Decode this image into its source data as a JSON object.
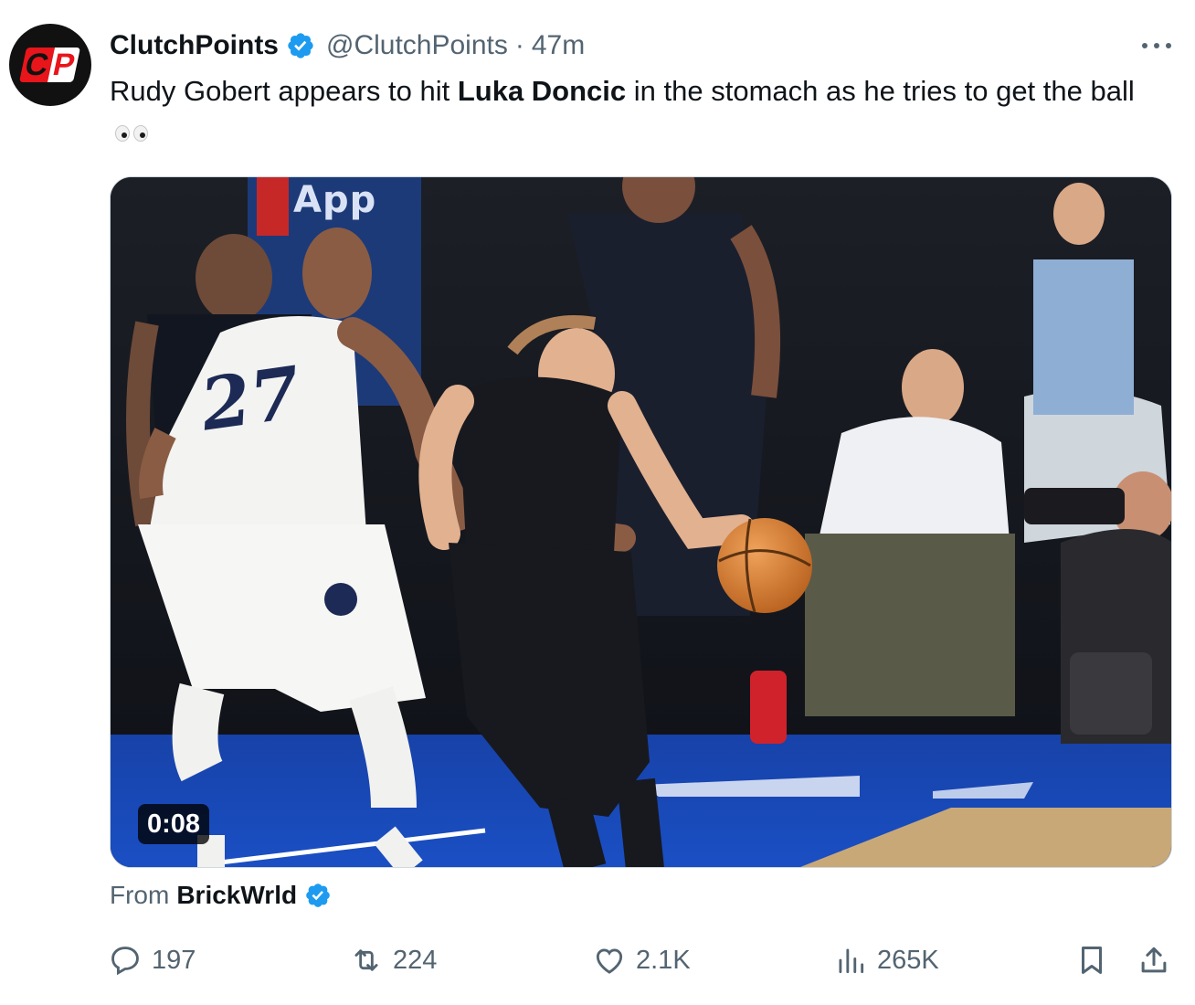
{
  "author": {
    "name": "ClutchPoints",
    "handle": "@ClutchPoints",
    "separator": "·",
    "time": "47m",
    "avatar_text_left": "C",
    "avatar_text_right": "P"
  },
  "tweet": {
    "text_before": "Rudy Gobert appears to hit ",
    "text_bold": "Luka Doncic",
    "text_after": " in the stomach as he tries to get the ball",
    "emoji": "eyes"
  },
  "media": {
    "duration": "0:08",
    "app_sign": "App",
    "jersey_number": "27"
  },
  "attribution": {
    "prefix": "From",
    "source": "BrickWrld"
  },
  "actions": {
    "replies": "197",
    "reposts": "224",
    "likes": "2.1K",
    "views": "265K"
  },
  "colors": {
    "verified": "#1d9bf0",
    "text_primary": "#0f1419",
    "text_secondary": "#536471",
    "avatar_red": "#e8151b"
  },
  "icons": [
    "verified-badge-icon",
    "more-icon",
    "reply-icon",
    "repost-icon",
    "like-icon",
    "views-icon",
    "bookmark-icon",
    "share-icon",
    "eyes-emoji-icon"
  ]
}
